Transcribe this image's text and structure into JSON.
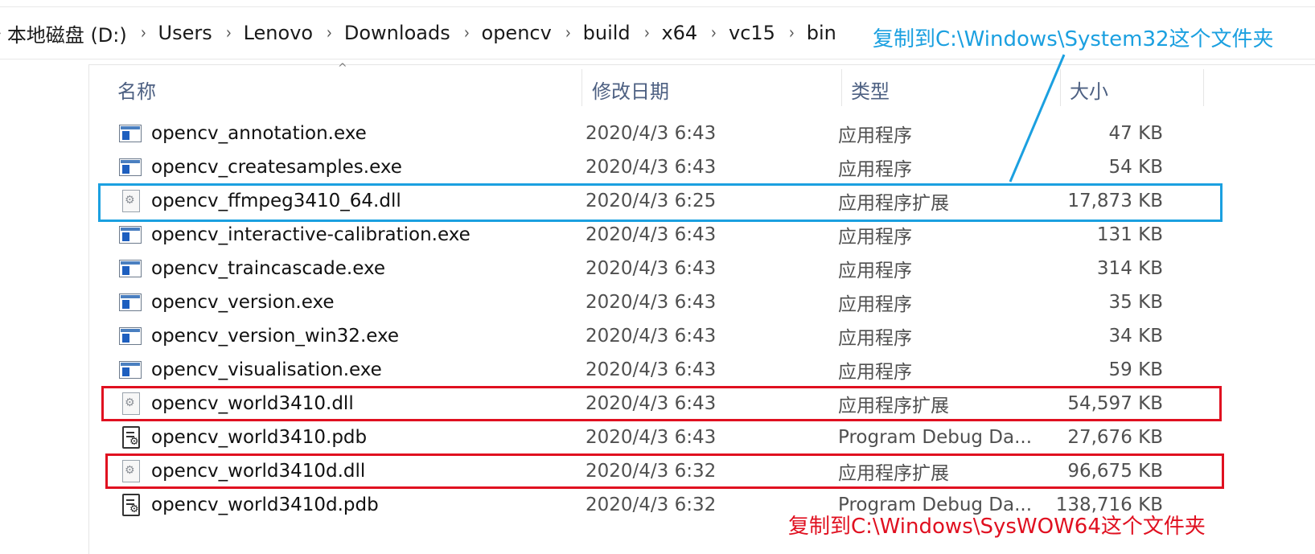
{
  "breadcrumb": {
    "items": [
      "本地磁盘 (D:)",
      "Users",
      "Lenovo",
      "Downloads",
      "opencv",
      "build",
      "x64",
      "vc15",
      "bin"
    ]
  },
  "columns": {
    "name": "名称",
    "date": "修改日期",
    "type": "类型",
    "size": "大小"
  },
  "files": [
    {
      "name": "opencv_annotation.exe",
      "date": "2020/4/3 6:43",
      "type": "应用程序",
      "size": "47 KB",
      "icon": "exe-icon"
    },
    {
      "name": "opencv_createsamples.exe",
      "date": "2020/4/3 6:43",
      "type": "应用程序",
      "size": "54 KB",
      "icon": "exe-icon"
    },
    {
      "name": "opencv_ffmpeg3410_64.dll",
      "date": "2020/4/3 6:25",
      "type": "应用程序扩展",
      "size": "17,873 KB",
      "icon": "dll-icon"
    },
    {
      "name": "opencv_interactive-calibration.exe",
      "date": "2020/4/3 6:43",
      "type": "应用程序",
      "size": "131 KB",
      "icon": "exe-icon"
    },
    {
      "name": "opencv_traincascade.exe",
      "date": "2020/4/3 6:43",
      "type": "应用程序",
      "size": "314 KB",
      "icon": "exe-icon"
    },
    {
      "name": "opencv_version.exe",
      "date": "2020/4/3 6:43",
      "type": "应用程序",
      "size": "35 KB",
      "icon": "exe-icon"
    },
    {
      "name": "opencv_version_win32.exe",
      "date": "2020/4/3 6:43",
      "type": "应用程序",
      "size": "34 KB",
      "icon": "exe-icon"
    },
    {
      "name": "opencv_visualisation.exe",
      "date": "2020/4/3 6:43",
      "type": "应用程序",
      "size": "59 KB",
      "icon": "exe-icon"
    },
    {
      "name": "opencv_world3410.dll",
      "date": "2020/4/3 6:43",
      "type": "应用程序扩展",
      "size": "54,597 KB",
      "icon": "dll-icon"
    },
    {
      "name": "opencv_world3410.pdb",
      "date": "2020/4/3 6:43",
      "type": "Program Debug Da...",
      "size": "27,676 KB",
      "icon": "pdb-icon"
    },
    {
      "name": "opencv_world3410d.dll",
      "date": "2020/4/3 6:32",
      "type": "应用程序扩展",
      "size": "96,675 KB",
      "icon": "dll-icon"
    },
    {
      "name": "opencv_world3410d.pdb",
      "date": "2020/4/3 6:32",
      "type": "Program Debug Da...",
      "size": "138,716 KB",
      "icon": "pdb-icon"
    }
  ],
  "annotations": {
    "blue_note": "复制到C:\\Windows\\System32这个文件夹",
    "red_note": "复制到C:\\Windows\\SysWOW64这个文件夹",
    "blue_color": "#1ba0e0",
    "red_color": "#e01020"
  }
}
